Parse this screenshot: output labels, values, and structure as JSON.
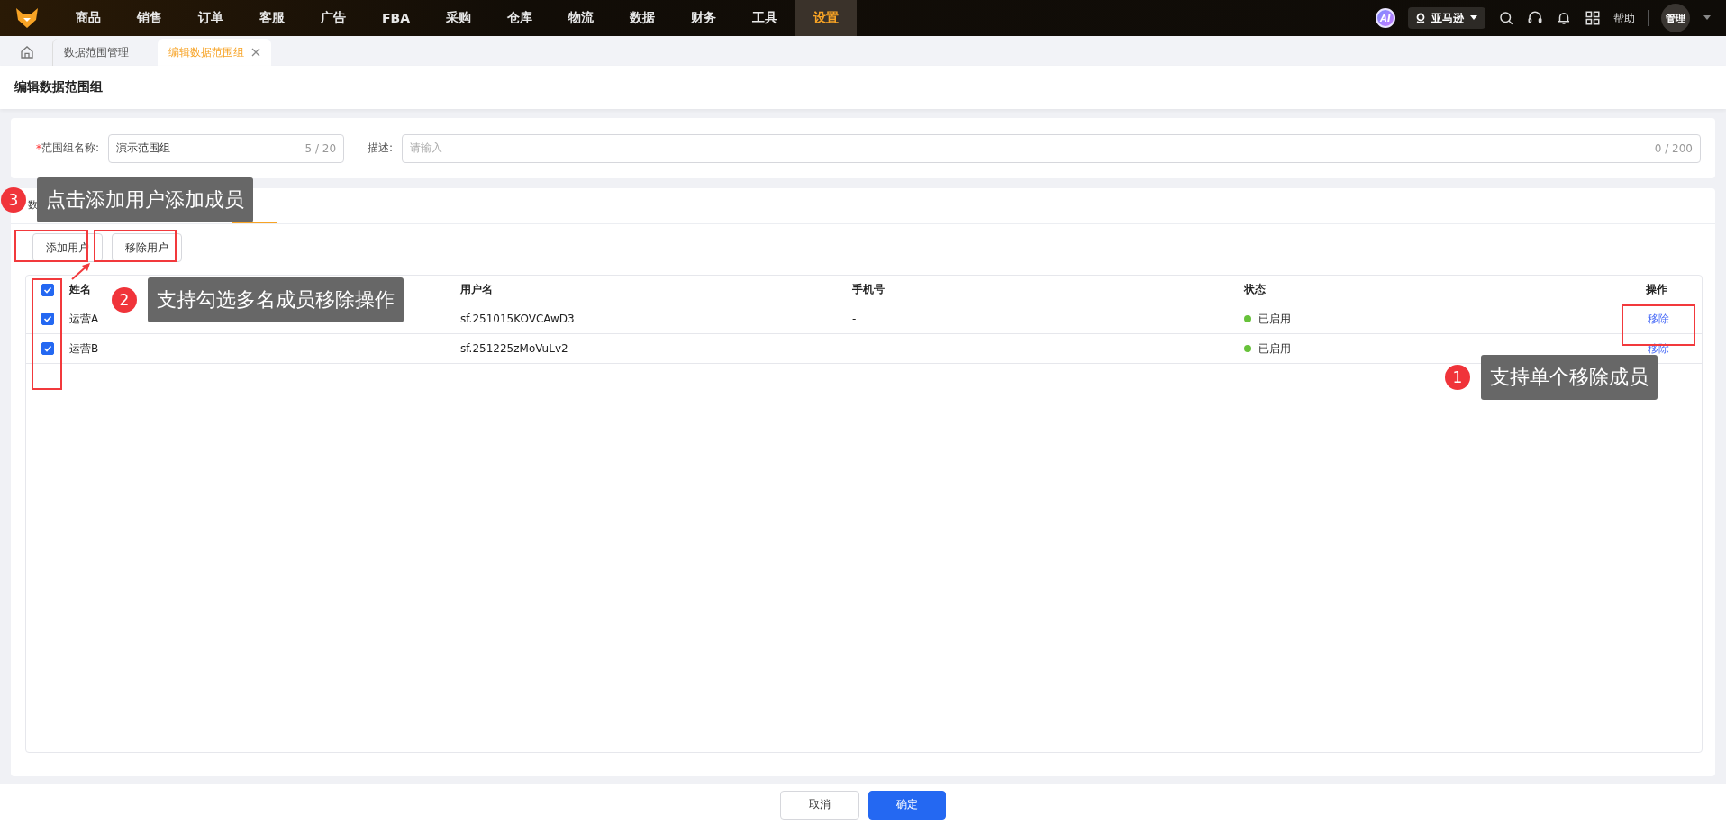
{
  "nav": {
    "items": [
      {
        "label": "商品",
        "selected": false
      },
      {
        "label": "销售",
        "selected": false
      },
      {
        "label": "订单",
        "selected": false
      },
      {
        "label": "客服",
        "selected": false
      },
      {
        "label": "广告",
        "selected": false
      },
      {
        "label": "FBA",
        "selected": false
      },
      {
        "label": "采购",
        "selected": false
      },
      {
        "label": "仓库",
        "selected": false
      },
      {
        "label": "物流",
        "selected": false
      },
      {
        "label": "数据",
        "selected": false
      },
      {
        "label": "财务",
        "selected": false
      },
      {
        "label": "工具",
        "selected": false
      },
      {
        "label": "设置",
        "selected": true
      }
    ],
    "ai_badge": "AI",
    "store": "亚马逊",
    "help": "帮助",
    "user": "管理"
  },
  "page_tabs": [
    {
      "label": "数据范围管理",
      "selected": false,
      "closable": false
    },
    {
      "label": "编辑数据范围组",
      "selected": true,
      "closable": true
    }
  ],
  "page_title": "编辑数据范围组",
  "form": {
    "required_mark": "*",
    "name_label": "范围组名称:",
    "name_value": "演示范围组",
    "name_count": "5 / 20",
    "desc_label": "描述:",
    "desc_placeholder": "请输入",
    "desc_count": "0 / 200"
  },
  "tabs": [
    {
      "label": "数",
      "selected": false
    },
    {
      "selected": true
    }
  ],
  "buttons": [
    "添加用户",
    "移除用户"
  ],
  "table": {
    "columns": [
      "姓名",
      "用户名",
      "手机号",
      "状态",
      "操作"
    ],
    "all_checked": true,
    "rows": [
      {
        "checked": true,
        "name": "运营A",
        "username": "sf.251015KOVCAwD3",
        "phone": "-",
        "status": "已启用",
        "color": "#67c23a",
        "action": "移除"
      },
      {
        "checked": true,
        "name": "运营B",
        "username": "sf.251225zMoVuLv2",
        "phone": "-",
        "status": "已启用",
        "color": "#67c23a",
        "action": "移除"
      }
    ]
  },
  "footer": {
    "cancel": "取消",
    "confirm": "确定"
  },
  "annotations": [
    {
      "number": "3",
      "text": "点击添加用户添加成员"
    },
    {
      "number": "2",
      "text": "支持勾选多名成员移除操作"
    },
    {
      "number": "1",
      "text": "支持单个移除成员"
    }
  ]
}
